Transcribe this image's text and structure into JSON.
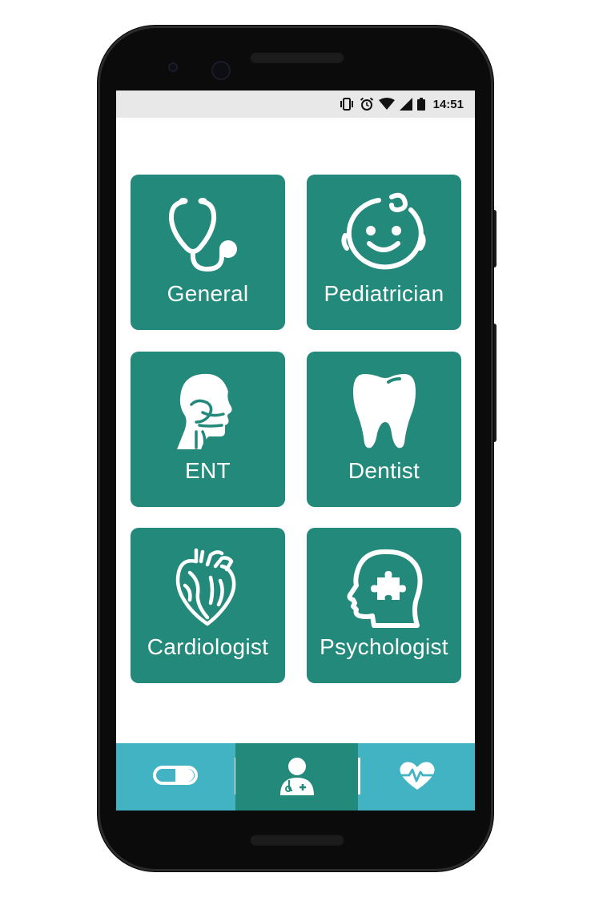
{
  "status_bar": {
    "time": "14:51",
    "icons": [
      "vibrate-icon",
      "alarm-icon",
      "wifi-icon",
      "signal-icon",
      "battery-icon"
    ]
  },
  "specialties": [
    {
      "label": "General",
      "icon": "stethoscope-icon"
    },
    {
      "label": "Pediatrician",
      "icon": "baby-face-icon"
    },
    {
      "label": "ENT",
      "icon": "head-profile-icon"
    },
    {
      "label": "Dentist",
      "icon": "tooth-icon"
    },
    {
      "label": "Cardiologist",
      "icon": "heart-icon"
    },
    {
      "label": "Psychologist",
      "icon": "brain-puzzle-icon"
    }
  ],
  "bottom_nav": {
    "items": [
      {
        "icon": "pill-icon",
        "selected": false
      },
      {
        "icon": "doctor-icon",
        "selected": true
      },
      {
        "icon": "heartbeat-icon",
        "selected": false
      }
    ]
  },
  "colors": {
    "tile": "#23897b",
    "nav_bar": "#41b3c2",
    "nav_selected": "#23897b",
    "status_bar": "#e8e8e8"
  }
}
